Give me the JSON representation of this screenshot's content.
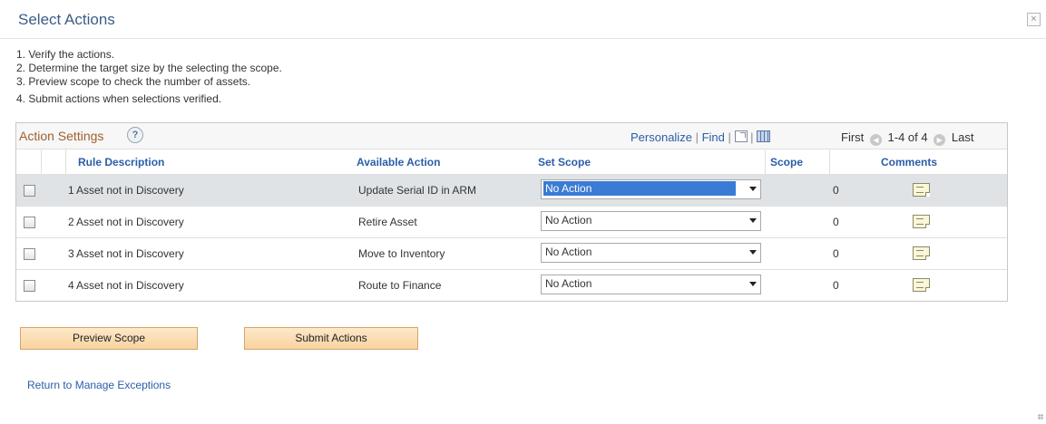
{
  "dialog": {
    "title": "Select Actions",
    "close_label": "×"
  },
  "instructions": [
    "1. Verify the actions.",
    "2. Determine the target size by the selecting the scope.",
    "3. Preview scope to check the number of assets.",
    "4. Submit actions when selections verified."
  ],
  "grid": {
    "title": "Action Settings",
    "help_label": "?",
    "personalize": "Personalize",
    "separator": "|",
    "find": "Find",
    "pager": {
      "first": "First",
      "range": "1-4 of 4",
      "last": "Last"
    },
    "columns": {
      "rule_description": "Rule Description",
      "available_action": "Available Action",
      "set_scope": "Set Scope",
      "scope": "Scope",
      "comments": "Comments"
    },
    "rows": [
      {
        "number": "1",
        "rule": "Asset not in Discovery",
        "action": "Update Serial ID in ARM",
        "set_scope": "No Action",
        "scope": "0"
      },
      {
        "number": "2",
        "rule": "Asset not in Discovery",
        "action": "Retire Asset",
        "set_scope": "No Action",
        "scope": "0"
      },
      {
        "number": "3",
        "rule": "Asset not in Discovery",
        "action": "Move to Inventory",
        "set_scope": "No Action",
        "scope": "0"
      },
      {
        "number": "4",
        "rule": "Asset not in Discovery",
        "action": "Route to Finance",
        "set_scope": "No Action",
        "scope": "0"
      }
    ]
  },
  "buttons": {
    "preview": "Preview Scope",
    "submit": "Submit Actions"
  },
  "links": {
    "return": "Return to Manage Exceptions"
  },
  "colors": {
    "title_blue": "#3c5d86",
    "link_blue": "#2a5ea8",
    "grid_title": "#a0602e",
    "button_bg": "#f8d3a0",
    "selected_row": "#dfe3e6"
  }
}
